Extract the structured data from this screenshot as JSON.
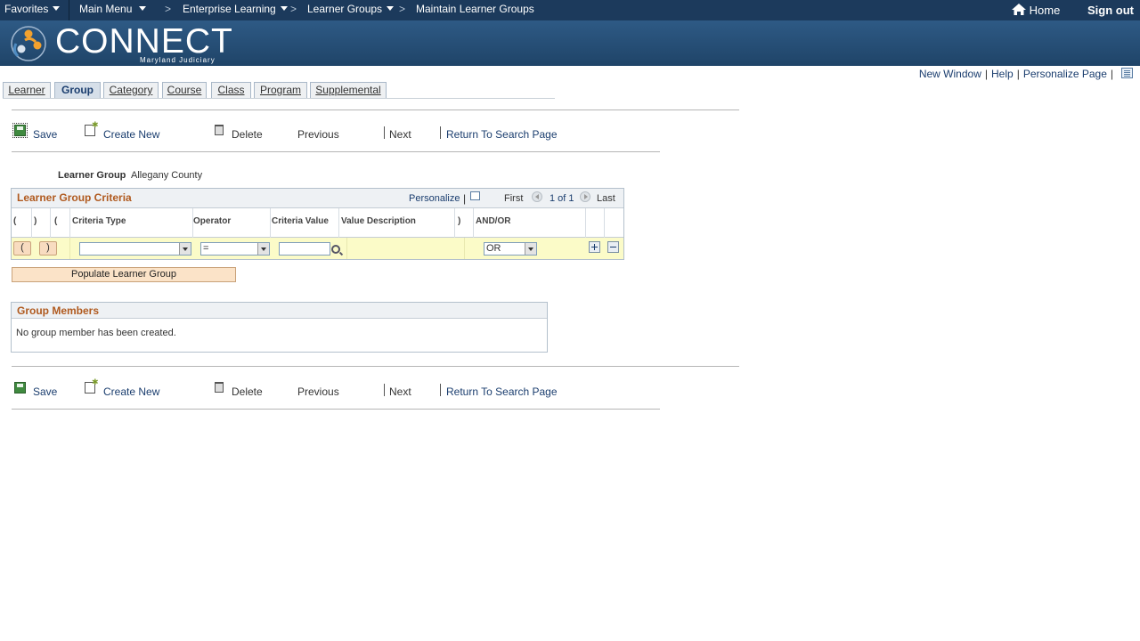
{
  "topnav": {
    "favorites": "Favorites",
    "main_menu": "Main Menu",
    "breadcrumbs": [
      "Enterprise Learning",
      "Learner Groups",
      "Maintain Learner Groups"
    ],
    "home": "Home",
    "sign_out": "Sign out"
  },
  "banner": {
    "logo_text": "CONNECT",
    "logo_sub": "Maryland Judiciary"
  },
  "pagelinks": {
    "new_window": "New Window",
    "help": "Help",
    "personalize_page": "Personalize Page"
  },
  "tabs": [
    "Learner",
    "Group",
    "Category",
    "Course",
    "Class",
    "Program",
    "Supplemental"
  ],
  "active_tab": "Group",
  "toolbar": {
    "save": "Save",
    "create_new": "Create New",
    "delete": "Delete",
    "previous": "Previous",
    "next": "Next",
    "return": "Return To Search Page"
  },
  "learner_group": {
    "label": "Learner Group",
    "value": "Allegany County"
  },
  "criteria": {
    "title": "Learner Group Criteria",
    "personalize": "Personalize",
    "first": "First",
    "range": "1 of 1",
    "last": "Last",
    "columns": [
      "(",
      ")",
      "(",
      "Criteria Type",
      "Operator",
      "Criteria Value",
      "Value Description",
      ")",
      "AND/OR"
    ],
    "row": {
      "open_paren": "(",
      "close_paren": ")",
      "criteria_type": "",
      "operator": "=",
      "criteria_value": "",
      "and_or": "OR"
    }
  },
  "populate_button": "Populate Learner Group",
  "members": {
    "title": "Group Members",
    "empty": "No group member has been created."
  },
  "colors": {
    "nav_bg": "#1c3a5c",
    "banner_bg": "#2e5a85",
    "section_title": "#b05a1f",
    "link": "#1a3d6e",
    "row_highlight": "#fbfbc8"
  }
}
